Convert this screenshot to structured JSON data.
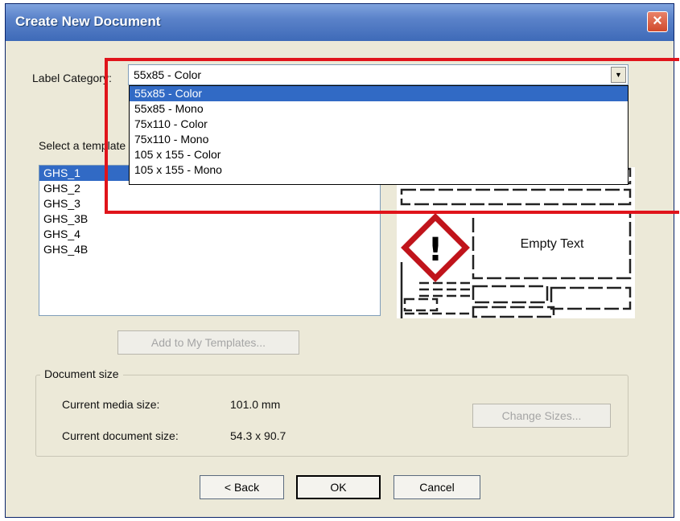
{
  "window": {
    "title": "Create New Document",
    "close_glyph": "×"
  },
  "category": {
    "label": "Label Category:",
    "value": "55x85 - Color",
    "options": [
      "55x85 - Color",
      "55x85 - Mono",
      "75x110 - Color",
      "75x110 - Mono",
      "105 x 155 - Color",
      "105 x 155 - Mono"
    ]
  },
  "templates": {
    "label": "Select a template",
    "items": [
      "GHS_1",
      "GHS_2",
      "GHS_3",
      "GHS_3B",
      "GHS_4",
      "GHS_4B"
    ],
    "selected": "GHS_1"
  },
  "preview": {
    "empty_text": "Empty Text",
    "pictogram_glyph": "!",
    "pictogram_color": "#c0141b"
  },
  "add_button": "Add to My Templates...",
  "document_size": {
    "title": "Document size",
    "media_label": "Current media size:",
    "media_value": "101.0 mm",
    "doc_label": "Current document size:",
    "doc_value": "54.3 x 90.7",
    "change_button": "Change Sizes..."
  },
  "buttons": {
    "back": "< Back",
    "ok": "OK",
    "cancel": "Cancel"
  },
  "highlight_color": "#e0141b"
}
